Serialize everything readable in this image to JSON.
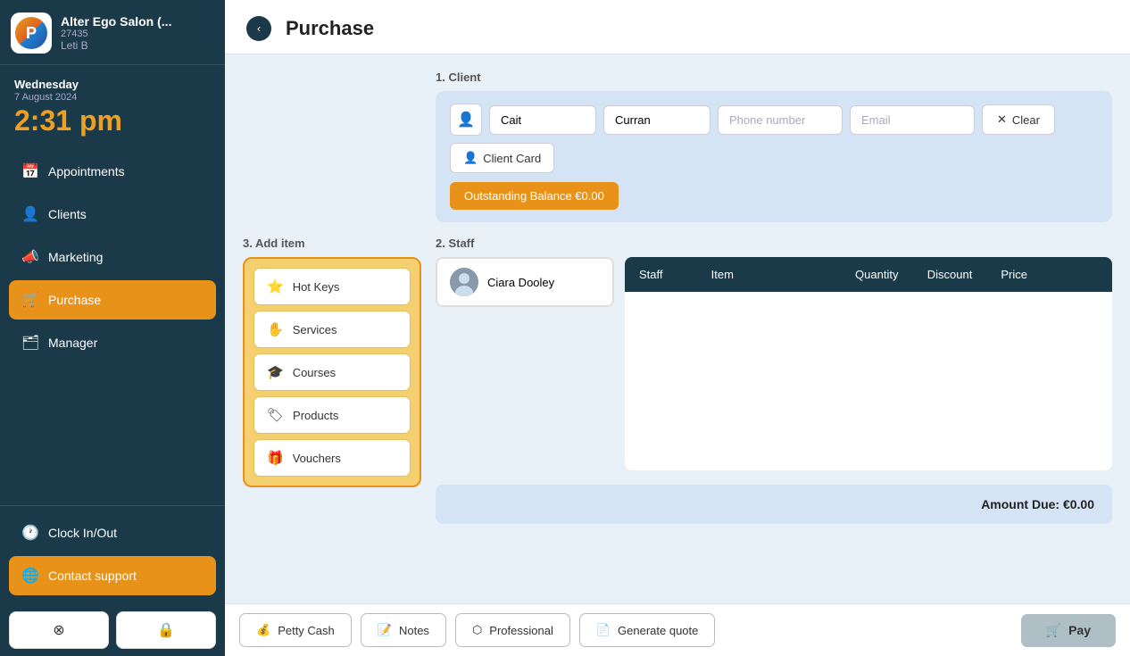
{
  "sidebar": {
    "app_name": "Alter Ego Salon (...",
    "app_id": "27435",
    "user": "Leti B",
    "day": "Wednesday",
    "date": "7 August 2024",
    "time": "2:31 pm",
    "nav_items": [
      {
        "id": "appointments",
        "label": "Appointments",
        "icon": "📅",
        "active": false
      },
      {
        "id": "clients",
        "label": "Clients",
        "icon": "👤",
        "active": false
      },
      {
        "id": "marketing",
        "label": "Marketing",
        "icon": "📣",
        "active": false
      },
      {
        "id": "purchase",
        "label": "Purchase",
        "icon": "🛒",
        "active": true
      },
      {
        "id": "manager",
        "label": "Manager",
        "icon": "🗂",
        "active": false
      }
    ],
    "bottom_items": [
      {
        "id": "clock-in-out",
        "label": "Clock In/Out",
        "icon": "🕐"
      },
      {
        "id": "contact-support",
        "label": "Contact support",
        "icon": "🌐"
      }
    ],
    "footer_buttons": [
      {
        "id": "close-btn",
        "icon": "⊗"
      },
      {
        "id": "lock-btn",
        "icon": "🔒"
      }
    ]
  },
  "main": {
    "title": "Purchase",
    "sections": {
      "client": {
        "label": "1. Client",
        "first_name": "Cait",
        "last_name": "Curran",
        "phone_placeholder": "Phone number",
        "email_placeholder": "Email",
        "clear_label": "Clear",
        "client_card_label": "Client Card",
        "outstanding_label": "Outstanding Balance €0.00"
      },
      "staff": {
        "label": "2. Staff",
        "staff_name": "Ciara Dooley"
      },
      "add_item": {
        "label": "3. Add item",
        "buttons": [
          {
            "id": "hot-keys",
            "label": "Hot Keys",
            "icon": "⭐"
          },
          {
            "id": "services",
            "label": "Services",
            "icon": "✋"
          },
          {
            "id": "courses",
            "label": "Courses",
            "icon": "🎓"
          },
          {
            "id": "products",
            "label": "Products",
            "icon": "🏷"
          },
          {
            "id": "vouchers",
            "label": "Vouchers",
            "icon": "🎁"
          }
        ]
      },
      "table": {
        "columns": [
          "Staff",
          "Item",
          "Quantity",
          "Discount",
          "Price",
          ""
        ]
      },
      "amount_due": "Amount Due: €0.00"
    },
    "footer": {
      "buttons": [
        {
          "id": "petty-cash",
          "label": "Petty Cash",
          "icon": "💰"
        },
        {
          "id": "notes",
          "label": "Notes",
          "icon": "📝"
        },
        {
          "id": "professional",
          "label": "Professional",
          "icon": "⬡"
        },
        {
          "id": "generate-quote",
          "label": "Generate quote",
          "icon": "📄"
        }
      ],
      "pay_label": "Pay",
      "pay_icon": "🛒"
    }
  }
}
